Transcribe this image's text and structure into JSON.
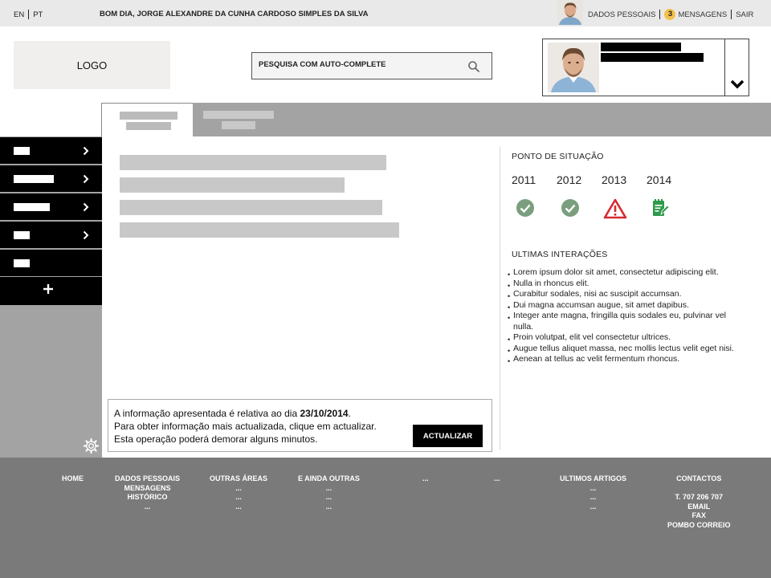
{
  "topbar": {
    "lang_en": "EN",
    "lang_pt": "PT",
    "greeting": "BOM DIA, JORGE ALEXANDRE DA CUNHA CARDOSO SIMPLES DA SILVA",
    "personal_data": "DADOS PESSOAIS",
    "messages_count": "3",
    "messages": "MENSAGENS",
    "logout": "SAIR"
  },
  "header": {
    "logo": "LOGO",
    "search_placeholder": "PESQUISA COM AUTO-COMPLETE"
  },
  "panel": {
    "status_title": "PONTO DE SITUAÇÃO",
    "years": [
      "2011",
      "2012",
      "2013",
      "2014"
    ],
    "year_status": [
      "ok-check-icon",
      "ok-check-icon",
      "warning-icon",
      "edit-document-icon"
    ],
    "interactions_title": "ULTIMAS INTERAÇÕES",
    "interactions": [
      "Lorem ipsum dolor sit amet, consectetur adipiscing elit.",
      "Nulla in rhoncus elit.",
      "Curabitur sodales, nisi ac suscipit accumsan.",
      "Dui magna accumsan augue, sit amet dapibus.",
      "Integer ante magna, fringilla quis sodales eu, pulvinar vel nulla.",
      "Proin volutpat, elit vel consectetur ultrices.",
      "Augue tellus aliquet massa, nec mollis lectus velit eget nisi.",
      "Aenean at tellus ac velit fermentum rhoncus."
    ]
  },
  "info": {
    "line1_prefix": "A informação apresentada é relativa ao dia ",
    "line1_date": "23/10/2014",
    "line1_suffix": ".",
    "line2": "Para obter informação mais actualizada, clique em actualizar.",
    "line3": "Esta operação poderá demorar alguns minutos.",
    "button": "ACTUALIZAR"
  },
  "footer": {
    "col1": [
      "HOME"
    ],
    "col2": [
      "DADOS PESSOAIS",
      "MENSAGENS",
      "HISTÓRICO",
      "..."
    ],
    "col3": [
      "OUTRAS ÁREAS",
      "...",
      "...",
      "..."
    ],
    "col4": [
      "E AINDA OUTRAS",
      "...",
      "...",
      "..."
    ],
    "col5": [
      "..."
    ],
    "col6": [
      "..."
    ],
    "col7": [
      "ULTIMOS ARTIGOS",
      "...",
      "...",
      "..."
    ],
    "col8": [
      "CONTACTOS",
      "",
      "T. 707 206 707",
      "EMAIL",
      "FAX",
      "POMBO CORREIO"
    ]
  },
  "colors": {
    "accent_badge": "#f3c14a",
    "ok_green": "#7a9e7e",
    "warning_red": "#d42b32",
    "edit_green": "#2e9a4a"
  }
}
